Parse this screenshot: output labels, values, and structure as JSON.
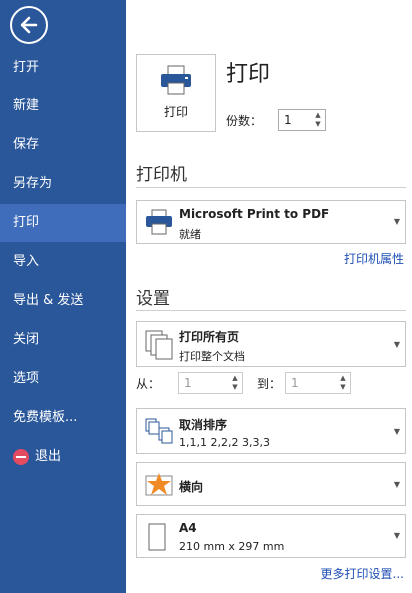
{
  "sidebar": {
    "items": [
      {
        "label": "打开"
      },
      {
        "label": "新建"
      },
      {
        "label": "保存"
      },
      {
        "label": "另存为"
      },
      {
        "label": "打印",
        "active": true
      },
      {
        "label": "导入"
      },
      {
        "label": "导出 & 发送"
      },
      {
        "label": "关闭"
      },
      {
        "label": "选项"
      },
      {
        "label": "免费模板..."
      },
      {
        "label": "退出"
      }
    ]
  },
  "print": {
    "button_label": "打印",
    "title": "打印",
    "copies_label": "份数：",
    "copies_value": "1"
  },
  "printer": {
    "section_title": "打印机",
    "name": "Microsoft Print to PDF",
    "status": "就绪",
    "properties_link": "打印机属性"
  },
  "settings": {
    "section_title": "设置",
    "pages": {
      "title": "打印所有页",
      "sub": "打印整个文档"
    },
    "range": {
      "from_label": "从：",
      "from_value": "1",
      "to_label": "到：",
      "to_value": "1"
    },
    "collate": {
      "title": "取消排序",
      "sub": "1,1,1   2,2,2   3,3,3"
    },
    "orientation": {
      "title": "横向"
    },
    "paper": {
      "title": "A4",
      "sub": "210 mm x 297 mm"
    },
    "more_link": "更多打印设置..."
  },
  "colors": {
    "sidebar": "#2a579a",
    "sidebar_active": "#3f6dbb",
    "link": "#1f4fb5"
  }
}
